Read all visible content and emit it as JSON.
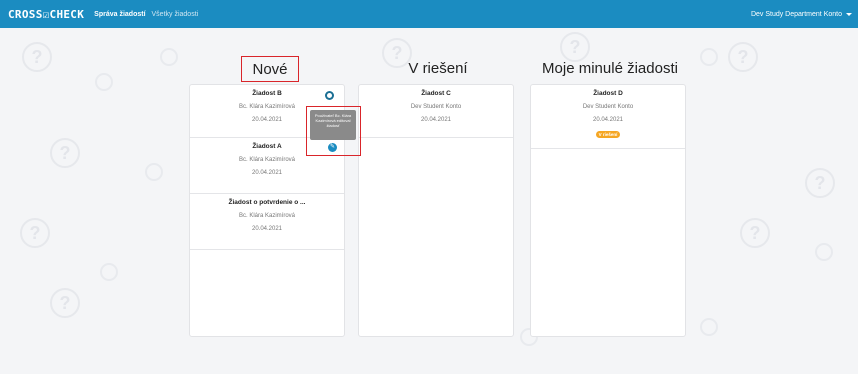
{
  "navbar": {
    "brand": "CROSS☑CHECK",
    "links": [
      {
        "label": "Správa žiadostí",
        "active": true
      },
      {
        "label": "Všetky žiadosti",
        "active": false
      }
    ],
    "user": "Dev Study Department Konto",
    "color": "#1b8cc1"
  },
  "columns": [
    {
      "title": "Nové",
      "cards": [
        {
          "title": "Žiadost B",
          "author": "Bc. Klára Kazimírová",
          "date": "20.04.2021",
          "icon": "chat-icon"
        },
        {
          "title": "Žiadost A",
          "author": "Bc. Klára Kazimírová",
          "date": "20.04.2021"
        },
        {
          "title": "Žiadost o potvrdenie o ...",
          "author": "Bc. Klára Kazimírová",
          "date": "20.04.2021"
        }
      ]
    },
    {
      "title": "V riešení",
      "cards": [
        {
          "title": "Žiadost C",
          "author": "Dev Student Konto",
          "date": "20.04.2021"
        }
      ]
    },
    {
      "title": "Moje minulé žiadosti",
      "cards": [
        {
          "title": "Žiadost D",
          "author": "Dev Student Konto",
          "date": "20.04.2021",
          "badge": "V riešení",
          "badge_color": "#f5a623"
        }
      ]
    }
  ],
  "tooltip": {
    "text": "Používateľ Bc. Klára Kazimírová editoval žiadosť",
    "icon": "edit-icon"
  }
}
